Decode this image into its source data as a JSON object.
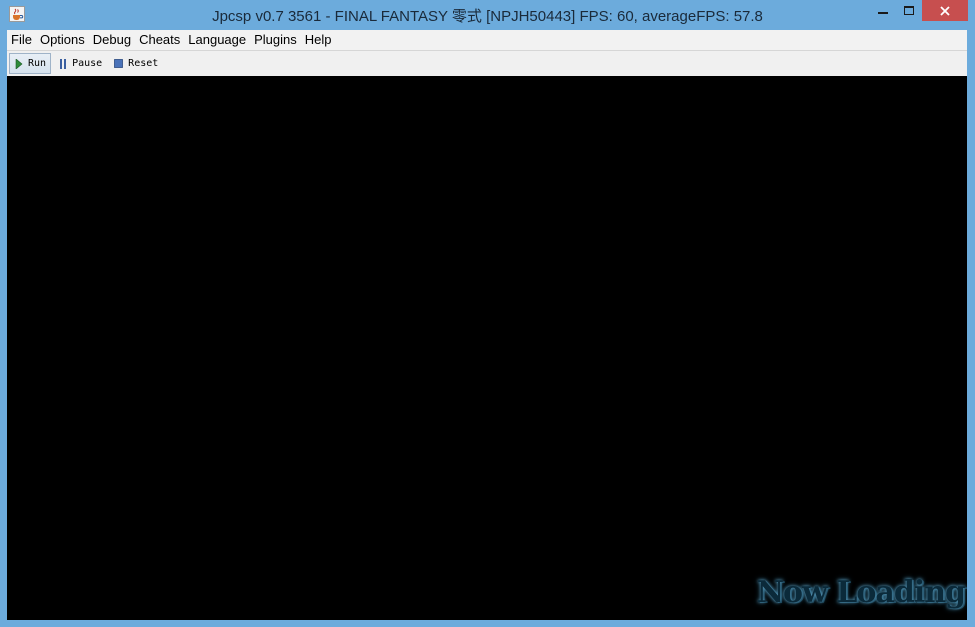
{
  "window": {
    "title": "Jpcsp v0.7 3561 - FINAL FANTASY 零式 [NPJH50443] FPS: 60, averageFPS: 57.8",
    "icon": "java-cup-icon",
    "controls": {
      "minimize": "─",
      "maximize": "□",
      "close": "✕"
    },
    "frame_color": "#6cabdc",
    "close_color": "#c74f4f"
  },
  "menubar": {
    "items": [
      {
        "label": "File"
      },
      {
        "label": "Options"
      },
      {
        "label": "Debug"
      },
      {
        "label": "Cheats"
      },
      {
        "label": "Language"
      },
      {
        "label": "Plugins"
      },
      {
        "label": "Help"
      }
    ]
  },
  "toolbar": {
    "run_label": "Run",
    "pause_label": "Pause",
    "reset_label": "Reset",
    "run_icon": "play-icon",
    "pause_icon": "pause-icon",
    "reset_icon": "stop-icon"
  },
  "screen": {
    "background": "#000000",
    "overlay_text": "Now Loading"
  }
}
